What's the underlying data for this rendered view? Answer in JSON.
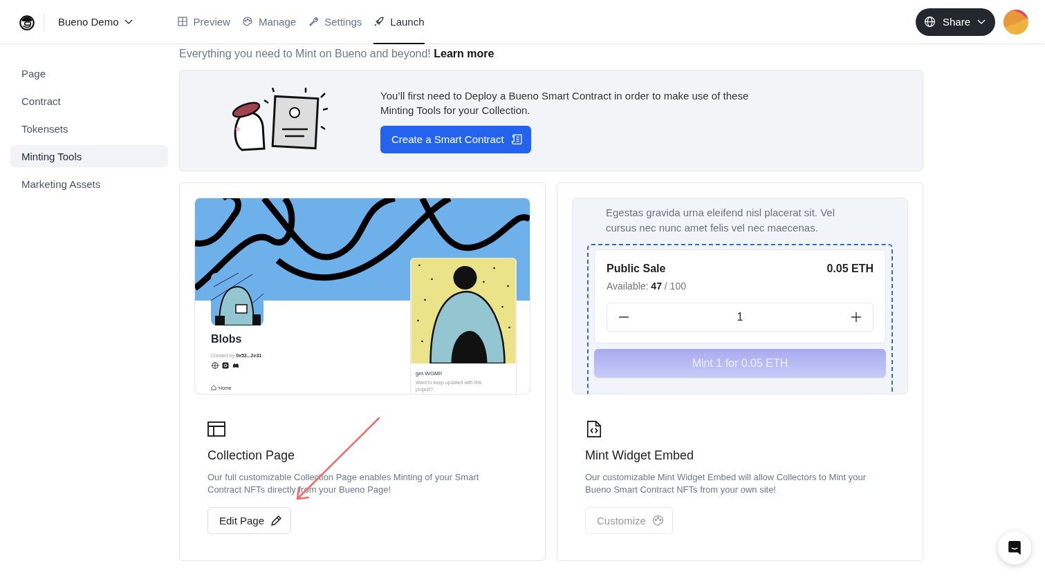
{
  "header": {
    "project": "Bueno Demo",
    "nav": [
      {
        "label": "Preview",
        "selected": false
      },
      {
        "label": "Manage",
        "selected": false
      },
      {
        "label": "Settings",
        "selected": false
      },
      {
        "label": "Launch",
        "selected": true
      }
    ],
    "share": "Share"
  },
  "sidebar": {
    "items": [
      {
        "label": "Page",
        "selected": false
      },
      {
        "label": "Contract",
        "selected": false
      },
      {
        "label": "Tokensets",
        "selected": false
      },
      {
        "label": "Minting Tools",
        "selected": true
      },
      {
        "label": "Marketing Assets",
        "selected": false
      }
    ]
  },
  "intro": {
    "text": "Everything you need to Mint on Bueno and beyond!",
    "link": "Learn more"
  },
  "banner": {
    "text": "You’ll first need to Deploy a Bueno Smart Contract in order to make use of these Minting Tools for your Collection.",
    "button": "Create a Smart Contract"
  },
  "cards": [
    {
      "kind": "collection",
      "title": "Collection Page",
      "description": "Our full customizable Collection Page enables Minting of your Smart Contract NFTs directly from your Bueno Page!",
      "button": {
        "label": "Edit Page",
        "disabled": false
      },
      "preview": {
        "name": "Blobs",
        "created_by": "Created by **0x53...2e31**",
        "nav": "Home",
        "post_title": "gm WGMI!",
        "post_text": "Want to keep updated with this project?"
      }
    },
    {
      "kind": "widget",
      "title": "Mint Widget Embed",
      "description": "Our customizable Mint Widget Embed will allow Collectors to Mint your Bueno Smart Contract NFTs from your own site!",
      "button": {
        "label": "Customize",
        "disabled": true
      },
      "preview": {
        "description": "Egestas gravida urna eleifend nisl placerat sit. Vel cursus nec nunc amet felis vel nec maecenas.",
        "sale": "Public Sale",
        "price": "0.05 ETH",
        "available": "Available: **47** / 100",
        "quantity": "1",
        "mint_button": {
          "label": "Mint 1 for 0.05 ETH",
          "disabled": true
        }
      }
    }
  ]
}
